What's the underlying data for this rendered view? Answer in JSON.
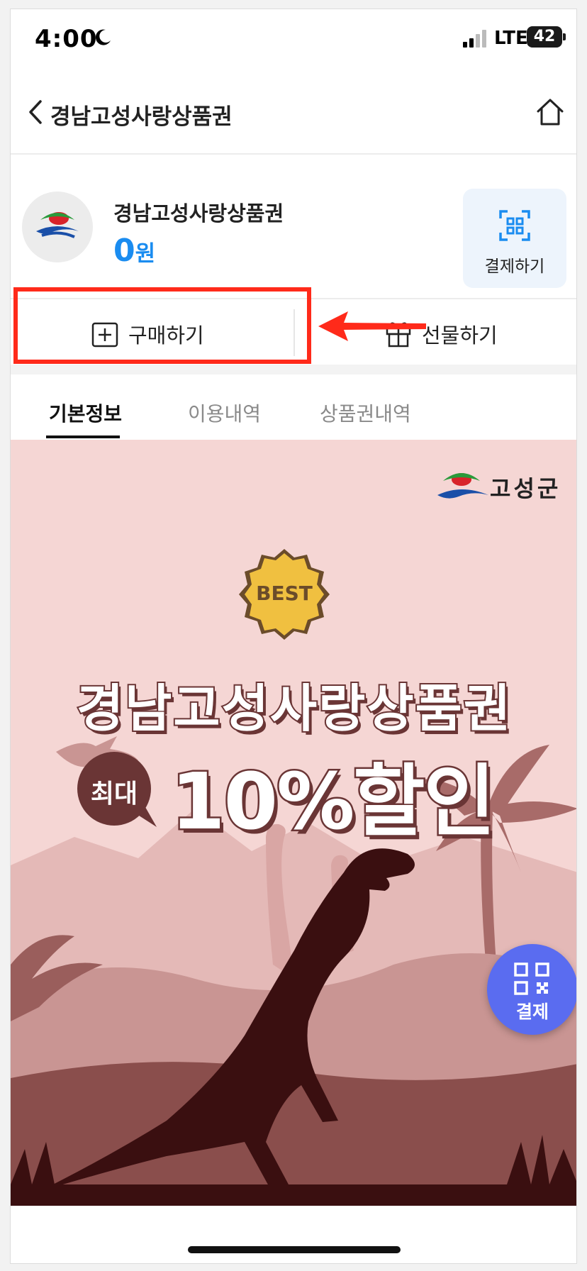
{
  "status_bar": {
    "time": "4:00",
    "network": "LTE",
    "battery": "42"
  },
  "header": {
    "title": "경남고성사랑상품권"
  },
  "card": {
    "name": "경남고성사랑상품권",
    "balance_value": "0",
    "balance_unit": "원",
    "pay_label": "결제하기"
  },
  "actions": {
    "buy_label": "구매하기",
    "gift_label": "선물하기"
  },
  "tabs": [
    {
      "label": "기본정보",
      "active": true
    },
    {
      "label": "이용내역",
      "active": false
    },
    {
      "label": "상품권내역",
      "active": false
    }
  ],
  "banner": {
    "brand": "고성군",
    "badge": "BEST",
    "title": "경남고성사랑상품권",
    "max_label": "최대",
    "discount": "10%할인"
  },
  "fab": {
    "label": "결제"
  },
  "colors": {
    "accent_blue": "#1a8cf0",
    "fab": "#5a6cf0",
    "annotation_red": "#ff2a1a",
    "banner_bg": "#f5d6d4",
    "silhouette": "#3a0f10"
  },
  "icons": [
    "moon-icon",
    "signal-icon",
    "back-icon",
    "home-icon",
    "qr-scan-icon",
    "plus-icon",
    "gift-icon",
    "qr-icon"
  ]
}
